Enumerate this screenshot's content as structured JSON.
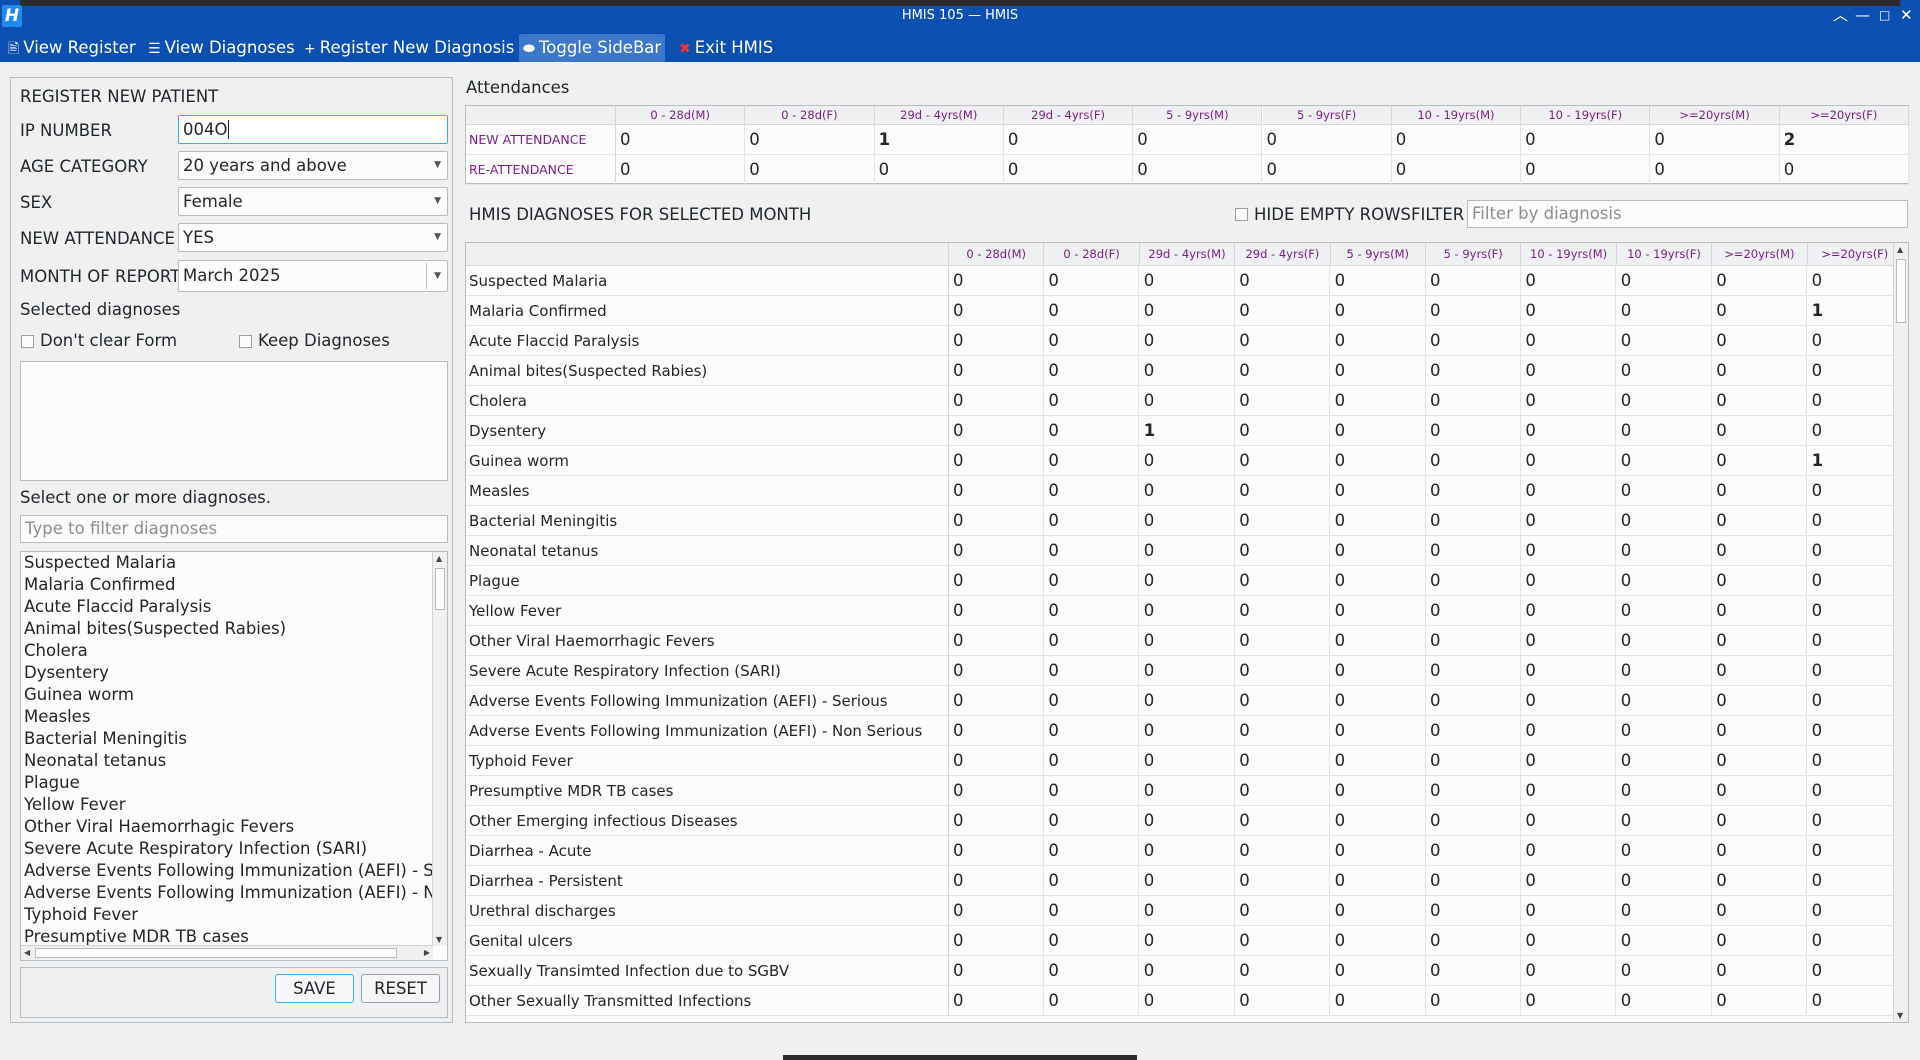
{
  "window": {
    "title": "HMIS 105 — HMIS",
    "app_icon": "H",
    "minimize_glyph": "—",
    "maximize_glyph": "□",
    "restore_glyph": "︿",
    "close_glyph": "✕"
  },
  "menu": [
    {
      "icon": "🖹",
      "label": "View Register"
    },
    {
      "icon": "☰",
      "label": "View Diagnoses"
    },
    {
      "icon": "+",
      "label": "Register New Diagnosis"
    },
    {
      "icon": "⬬",
      "label": "Toggle SideBar"
    },
    {
      "icon": "✖",
      "label": "Exit HMIS"
    }
  ],
  "form": {
    "heading": "REGISTER NEW PATIENT",
    "ip_label": "IP NUMBER",
    "ip_value": "004O",
    "age_label": "AGE CATEGORY",
    "age_value": "20 years and above",
    "sex_label": "SEX",
    "sex_value": "Female",
    "attendance_label": "NEW ATTENDANCE",
    "attendance_value": "YES",
    "month_label": "MONTH OF REPORT",
    "month_value": "March 2025",
    "selected_label": "Selected diagnoses",
    "dont_clear_label": "Don't clear Form",
    "keep_label": "Keep Diagnoses",
    "select_hint": "Select one or more diagnoses.",
    "filter_placeholder": "Type to filter diagnoses",
    "save_label": "SAVE",
    "reset_label": "RESET",
    "diagnoses_list": [
      "Suspected Malaria",
      "Malaria Confirmed",
      "Acute Flaccid Paralysis",
      "Animal bites(Suspected Rabies)",
      "Cholera",
      "Dysentery",
      "Guinea worm",
      "Measles",
      "Bacterial Meningitis",
      "Neonatal tetanus",
      "Plague",
      "Yellow Fever",
      "Other Viral Haemorrhagic Fevers",
      "Severe Acute Respiratory Infection (SARI)",
      "Adverse Events Following Immunization (AEFI) - Serious",
      "Adverse Events Following Immunization (AEFI) - Non Serious",
      "Typhoid Fever",
      "Presumptive MDR TB cases"
    ]
  },
  "attendances": {
    "title": "Attendances",
    "columns": [
      "0 - 28d(M)",
      "0 - 28d(F)",
      "29d - 4yrs(M)",
      "29d - 4yrs(F)",
      "5 - 9yrs(M)",
      "5 - 9yrs(F)",
      "10 - 19yrs(M)",
      "10 - 19yrs(F)",
      ">=20yrs(M)",
      ">=20yrs(F)"
    ],
    "rows": [
      {
        "label": "NEW ATTENDANCE",
        "values": [
          "0",
          "0",
          "1",
          "0",
          "0",
          "0",
          "0",
          "0",
          "0",
          "2"
        ]
      },
      {
        "label": "RE-ATTENDANCE",
        "values": [
          "0",
          "0",
          "0",
          "0",
          "0",
          "0",
          "0",
          "0",
          "0",
          "0"
        ]
      }
    ]
  },
  "diagnoses_table": {
    "title": "HMIS DIAGNOSES FOR SELECTED MONTH",
    "hide_empty_label": "HIDE EMPTY ROWS",
    "filter_label": "FILTER",
    "filter_placeholder": "Filter by diagnosis",
    "columns": [
      "0 - 28d(M)",
      "0 - 28d(F)",
      "29d - 4yrs(M)",
      "29d - 4yrs(F)",
      "5 - 9yrs(M)",
      "5 - 9yrs(F)",
      "10 - 19yrs(M)",
      "10 - 19yrs(F)",
      ">=20yrs(M)",
      ">=20yrs(F)"
    ],
    "rows": [
      {
        "name": "Suspected Malaria",
        "values": [
          "0",
          "0",
          "0",
          "0",
          "0",
          "0",
          "0",
          "0",
          "0",
          "0"
        ]
      },
      {
        "name": "Malaria Confirmed",
        "values": [
          "0",
          "0",
          "0",
          "0",
          "0",
          "0",
          "0",
          "0",
          "0",
          "1"
        ]
      },
      {
        "name": "Acute Flaccid Paralysis",
        "values": [
          "0",
          "0",
          "0",
          "0",
          "0",
          "0",
          "0",
          "0",
          "0",
          "0"
        ]
      },
      {
        "name": "Animal bites(Suspected Rabies)",
        "values": [
          "0",
          "0",
          "0",
          "0",
          "0",
          "0",
          "0",
          "0",
          "0",
          "0"
        ]
      },
      {
        "name": "Cholera",
        "values": [
          "0",
          "0",
          "0",
          "0",
          "0",
          "0",
          "0",
          "0",
          "0",
          "0"
        ]
      },
      {
        "name": "Dysentery",
        "values": [
          "0",
          "0",
          "1",
          "0",
          "0",
          "0",
          "0",
          "0",
          "0",
          "0"
        ]
      },
      {
        "name": "Guinea worm",
        "values": [
          "0",
          "0",
          "0",
          "0",
          "0",
          "0",
          "0",
          "0",
          "0",
          "1"
        ]
      },
      {
        "name": "Measles",
        "values": [
          "0",
          "0",
          "0",
          "0",
          "0",
          "0",
          "0",
          "0",
          "0",
          "0"
        ]
      },
      {
        "name": "Bacterial Meningitis",
        "values": [
          "0",
          "0",
          "0",
          "0",
          "0",
          "0",
          "0",
          "0",
          "0",
          "0"
        ]
      },
      {
        "name": "Neonatal tetanus",
        "values": [
          "0",
          "0",
          "0",
          "0",
          "0",
          "0",
          "0",
          "0",
          "0",
          "0"
        ]
      },
      {
        "name": "Plague",
        "values": [
          "0",
          "0",
          "0",
          "0",
          "0",
          "0",
          "0",
          "0",
          "0",
          "0"
        ]
      },
      {
        "name": "Yellow Fever",
        "values": [
          "0",
          "0",
          "0",
          "0",
          "0",
          "0",
          "0",
          "0",
          "0",
          "0"
        ]
      },
      {
        "name": "Other Viral Haemorrhagic Fevers",
        "values": [
          "0",
          "0",
          "0",
          "0",
          "0",
          "0",
          "0",
          "0",
          "0",
          "0"
        ]
      },
      {
        "name": "Severe Acute Respiratory Infection (SARI)",
        "values": [
          "0",
          "0",
          "0",
          "0",
          "0",
          "0",
          "0",
          "0",
          "0",
          "0"
        ]
      },
      {
        "name": "Adverse Events Following Immunization (AEFI) - Serious",
        "values": [
          "0",
          "0",
          "0",
          "0",
          "0",
          "0",
          "0",
          "0",
          "0",
          "0"
        ]
      },
      {
        "name": "Adverse Events Following Immunization (AEFI) - Non Serious",
        "values": [
          "0",
          "0",
          "0",
          "0",
          "0",
          "0",
          "0",
          "0",
          "0",
          "0"
        ]
      },
      {
        "name": "Typhoid Fever",
        "values": [
          "0",
          "0",
          "0",
          "0",
          "0",
          "0",
          "0",
          "0",
          "0",
          "0"
        ]
      },
      {
        "name": "Presumptive MDR TB cases",
        "values": [
          "0",
          "0",
          "0",
          "0",
          "0",
          "0",
          "0",
          "0",
          "0",
          "0"
        ]
      },
      {
        "name": "Other Emerging infectious Diseases",
        "values": [
          "0",
          "0",
          "0",
          "0",
          "0",
          "0",
          "0",
          "0",
          "0",
          "0"
        ]
      },
      {
        "name": "Diarrhea - Acute",
        "values": [
          "0",
          "0",
          "0",
          "0",
          "0",
          "0",
          "0",
          "0",
          "0",
          "0"
        ]
      },
      {
        "name": "Diarrhea - Persistent",
        "values": [
          "0",
          "0",
          "0",
          "0",
          "0",
          "0",
          "0",
          "0",
          "0",
          "0"
        ]
      },
      {
        "name": "Urethral discharges",
        "values": [
          "0",
          "0",
          "0",
          "0",
          "0",
          "0",
          "0",
          "0",
          "0",
          "0"
        ]
      },
      {
        "name": "Genital ulcers",
        "values": [
          "0",
          "0",
          "0",
          "0",
          "0",
          "0",
          "0",
          "0",
          "0",
          "0"
        ]
      },
      {
        "name": "Sexually Transimted Infection due to SGBV",
        "values": [
          "0",
          "0",
          "0",
          "0",
          "0",
          "0",
          "0",
          "0",
          "0",
          "0"
        ]
      },
      {
        "name": "Other Sexually Transmitted Infections",
        "values": [
          "0",
          "0",
          "0",
          "0",
          "0",
          "0",
          "0",
          "0",
          "0",
          "0"
        ]
      }
    ]
  }
}
